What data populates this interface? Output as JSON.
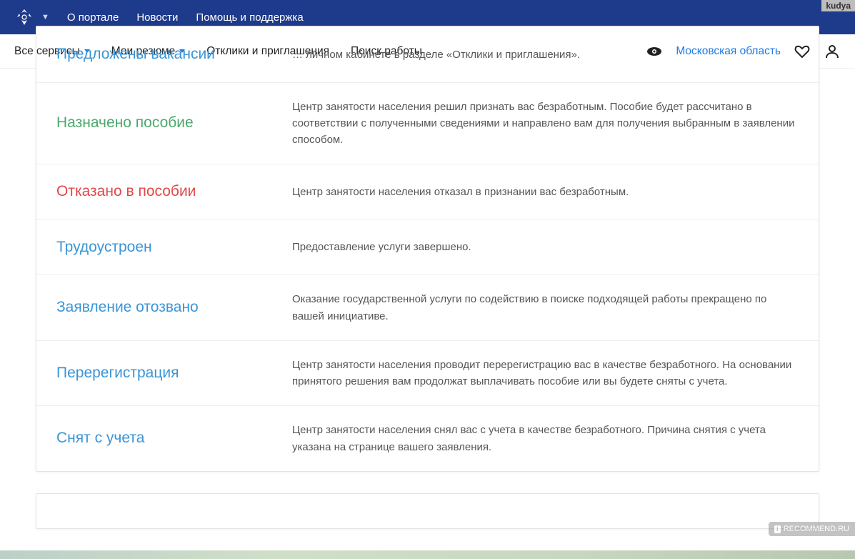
{
  "watermarks": {
    "top": "kudya",
    "bottom": "RECOMMEND.RU"
  },
  "topnav": {
    "items": [
      "О портале",
      "Новости",
      "Помощь и поддержка"
    ]
  },
  "nav": {
    "all_services": "Все сервисы",
    "my_resumes": "Мои резюме",
    "responses": "Отклики и приглашения",
    "job_search": "Поиск работы",
    "region": "Московская область"
  },
  "rows": [
    {
      "title": "Предложены вакансии",
      "color": "c-blue",
      "desc": "… личном кабинете в разделе «Отклики и приглашения»."
    },
    {
      "title": "Назначено пособие",
      "color": "c-green",
      "desc": "Центр занятости населения решил признать вас безработным. Пособие будет рассчитано в соответствии с полученными сведениями и направлено вам для получения выбранным в заявлении способом."
    },
    {
      "title": "Отказано в пособии",
      "color": "c-red",
      "desc": "Центр занятости населения отказал в признании вас безработным."
    },
    {
      "title": "Трудоустроен",
      "color": "c-blue",
      "desc": "Предоставление услуги завершено."
    },
    {
      "title": "Заявление отозвано",
      "color": "c-blue",
      "desc": "Оказание государственной услуги по содействию в поиске подходящей работы прекращено по вашей инициативе."
    },
    {
      "title": "Перерегистрация",
      "color": "c-blue",
      "desc": "Центр занятости населения проводит перерегистрацию вас в качестве безработного. На основании принятого решения вам продолжат выплачивать пособие или вы будете сняты с учета."
    },
    {
      "title": "Снят с учета",
      "color": "c-blue",
      "desc": "Центр занятости населения снял вас с учета в качестве безработного. Причина снятия с учета указана на странице вашего заявления."
    }
  ]
}
